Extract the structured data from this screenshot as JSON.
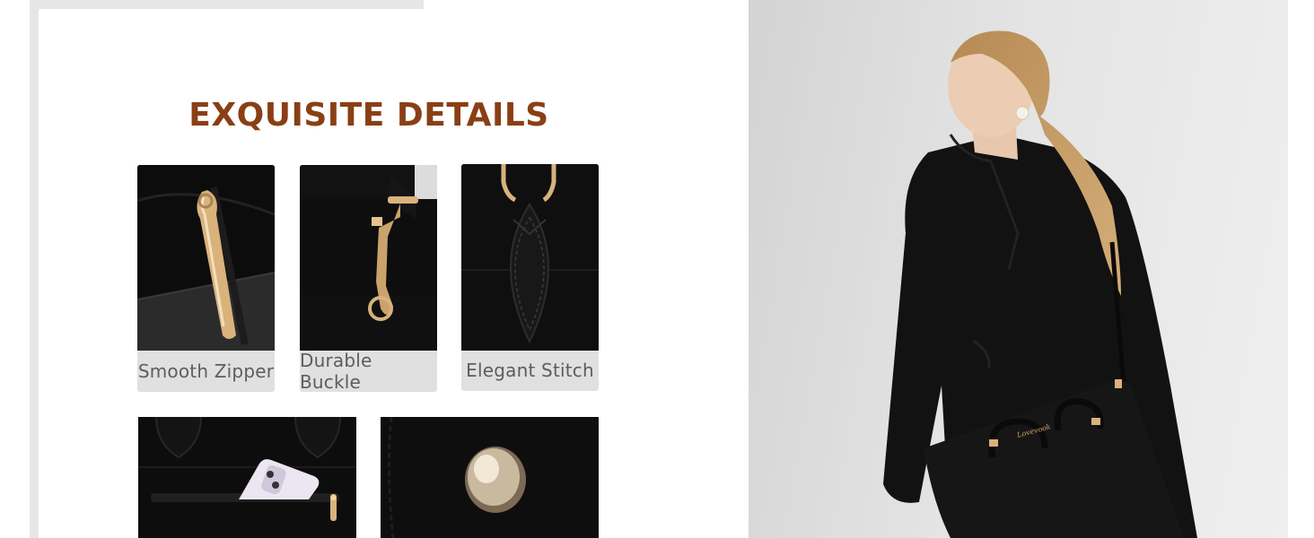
{
  "section": {
    "title": "EXQUISITE DETAILS"
  },
  "features": [
    {
      "label": "Smooth Zipper",
      "icon": "zipper-pull-photo"
    },
    {
      "label": "Durable Buckle",
      "icon": "buckle-clasp-photo"
    },
    {
      "label": "Elegant Stitch",
      "icon": "stitched-handle-photo"
    }
  ],
  "details_bottom": [
    {
      "icon": "front-pocket-phone-photo"
    },
    {
      "icon": "metal-stud-photo"
    }
  ],
  "product": {
    "bag_brand_mark": "Lovevook"
  },
  "colors": {
    "title": "#8a3f15",
    "label_bg": "#e0e0e0",
    "label_text": "#5d5d5d",
    "leather": "#0b0b0b",
    "gold_hardware": "#d9b27c"
  }
}
